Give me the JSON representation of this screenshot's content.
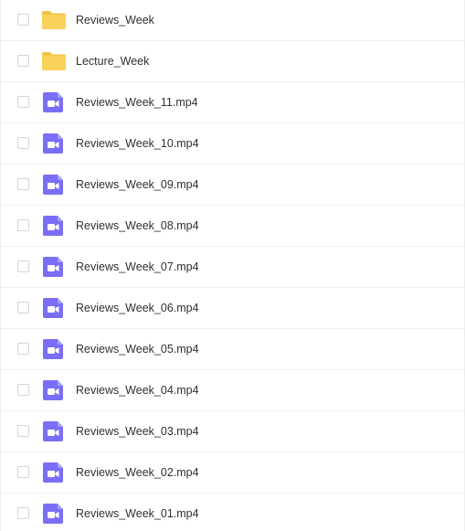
{
  "colors": {
    "folder": "#f9d25b",
    "folder_tab": "#f1c143",
    "video": "#7b6ef6",
    "text": "#303030",
    "divider": "#f0f0f0",
    "checkbox_border": "#d6d6d6"
  },
  "files": [
    {
      "name": "Reviews_Week",
      "type": "folder",
      "icon": "folder-icon"
    },
    {
      "name": "Lecture_Week",
      "type": "folder",
      "icon": "folder-icon"
    },
    {
      "name": "Reviews_Week_11.mp4",
      "type": "video",
      "icon": "video-file-icon"
    },
    {
      "name": "Reviews_Week_10.mp4",
      "type": "video",
      "icon": "video-file-icon"
    },
    {
      "name": "Reviews_Week_09.mp4",
      "type": "video",
      "icon": "video-file-icon"
    },
    {
      "name": "Reviews_Week_08.mp4",
      "type": "video",
      "icon": "video-file-icon"
    },
    {
      "name": "Reviews_Week_07.mp4",
      "type": "video",
      "icon": "video-file-icon"
    },
    {
      "name": "Reviews_Week_06.mp4",
      "type": "video",
      "icon": "video-file-icon"
    },
    {
      "name": "Reviews_Week_05.mp4",
      "type": "video",
      "icon": "video-file-icon"
    },
    {
      "name": "Reviews_Week_04.mp4",
      "type": "video",
      "icon": "video-file-icon"
    },
    {
      "name": "Reviews_Week_03.mp4",
      "type": "video",
      "icon": "video-file-icon"
    },
    {
      "name": "Reviews_Week_02.mp4",
      "type": "video",
      "icon": "video-file-icon"
    },
    {
      "name": "Reviews_Week_01.mp4",
      "type": "video",
      "icon": "video-file-icon"
    }
  ]
}
